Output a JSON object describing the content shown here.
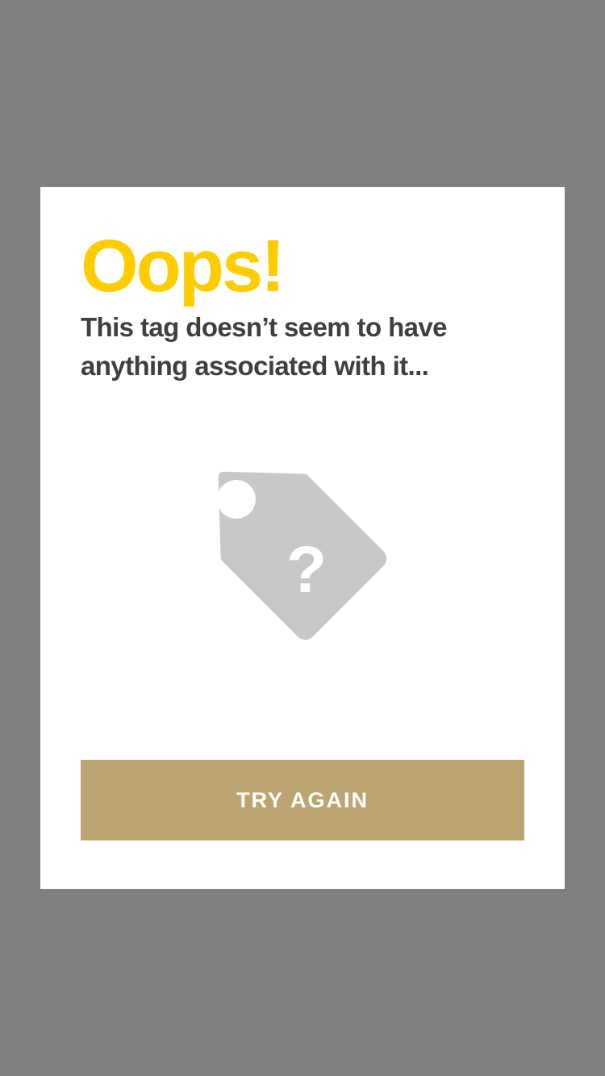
{
  "dialog": {
    "title": "Oops!",
    "message": "This tag doesn’t seem to have anything associated with it...",
    "illustration_icon": "question-tag-icon",
    "illustration_glyph": "?",
    "button_label": "TRY AGAIN"
  },
  "colors": {
    "backdrop": "#808080",
    "dialog_background": "#ffffff",
    "title": "#ffcc00",
    "message": "#3f3f3f",
    "tag_fill": "#c8c8c8",
    "button_background": "#bca572",
    "button_text": "#ffffff"
  }
}
